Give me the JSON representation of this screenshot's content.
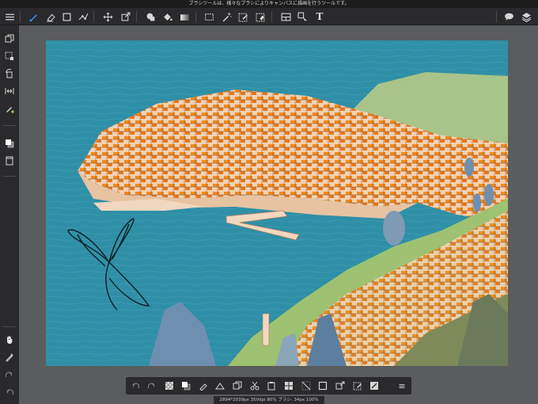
{
  "tip_bar": {
    "text": "ブラシツールは、様々なブラシによりキャンバスに描画を行うツールです。"
  },
  "top_toolbar": {
    "text_tool_label": "T",
    "colors": {
      "accent": "#3d8bf2",
      "icon": "#d6d6d6",
      "background": "#2a2a2c"
    }
  },
  "canvas": {
    "colors": {
      "sea": "#2f8fa6",
      "roof": "#f08a1a",
      "wall": "#f1d7bf",
      "grass": "#9ec272",
      "tree": "#6f8fb0"
    }
  },
  "bottom_toolbar": {
    "menu_label": "≡"
  },
  "status_bar": {
    "text": "2894*2039px 350dpi 80% ブラシ: 34px 100%"
  }
}
